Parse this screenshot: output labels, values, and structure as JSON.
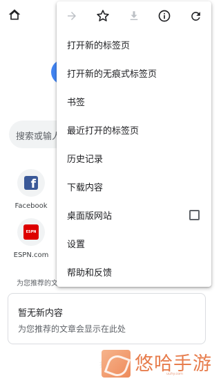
{
  "page": {
    "search_placeholder": "搜索或输人",
    "shortcuts": [
      {
        "label": "Facebook",
        "logo_text": "f"
      },
      {
        "label": "ESPN.com",
        "logo_text": "ESPN"
      }
    ],
    "feed_hint": "为您推荐的文",
    "feed_card": {
      "title": "暂无新内容",
      "subtitle": "为您推荐的文章会显示在此处"
    },
    "bottom_fragment": "推荐"
  },
  "menu": {
    "toolbar": [
      {
        "icon": "forward-arrow-icon",
        "enabled": false
      },
      {
        "icon": "bookmark-star-icon",
        "enabled": true
      },
      {
        "icon": "download-icon",
        "enabled": false
      },
      {
        "icon": "info-icon",
        "enabled": true
      },
      {
        "icon": "refresh-icon",
        "enabled": true
      }
    ],
    "items": [
      {
        "label": "打开新的标签页"
      },
      {
        "label": "打开新的无痕式标签页"
      },
      {
        "label": "书签"
      },
      {
        "label": "最近打开的标签页"
      },
      {
        "label": "历史记录"
      },
      {
        "label": "下载内容"
      },
      {
        "label": "桌面版网站",
        "checkbox": false
      },
      {
        "label": "设置"
      },
      {
        "label": "帮助和反馈"
      }
    ]
  },
  "watermark": {
    "text": "悠哈手游",
    "domain": "uuhy.com"
  },
  "colors": {
    "accent_blue": "#4285f4",
    "icon_grey": "#5f6368",
    "icon_disabled": "#bdc1c6",
    "watermark_orange": "#e77d4d"
  }
}
